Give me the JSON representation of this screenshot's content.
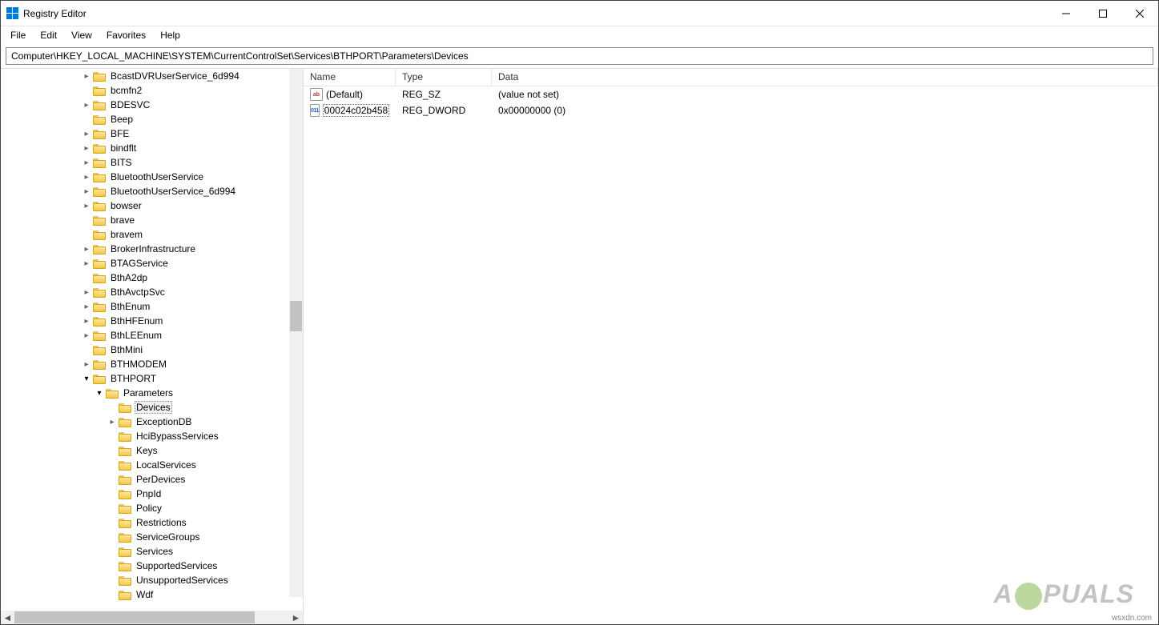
{
  "window": {
    "title": "Registry Editor"
  },
  "menu": {
    "file": "File",
    "edit": "Edit",
    "view": "View",
    "favorites": "Favorites",
    "help": "Help"
  },
  "addressbar": {
    "path": "Computer\\HKEY_LOCAL_MACHINE\\SYSTEM\\CurrentControlSet\\Services\\BTHPORT\\Parameters\\Devices"
  },
  "headers": {
    "name": "Name",
    "type": "Type",
    "data": "Data"
  },
  "values": [
    {
      "icon": "str",
      "name": "(Default)",
      "type": "REG_SZ",
      "data": "(value not set)",
      "selected": false
    },
    {
      "icon": "bin",
      "name": "00024c02b458",
      "type": "REG_DWORD",
      "data": "0x00000000 (0)",
      "selected": true
    }
  ],
  "tree": [
    {
      "depth": 6,
      "expander": ">",
      "label": "BcastDVRUserService_6d994"
    },
    {
      "depth": 6,
      "expander": "",
      "label": "bcmfn2"
    },
    {
      "depth": 6,
      "expander": ">",
      "label": "BDESVC"
    },
    {
      "depth": 6,
      "expander": "",
      "label": "Beep"
    },
    {
      "depth": 6,
      "expander": ">",
      "label": "BFE"
    },
    {
      "depth": 6,
      "expander": ">",
      "label": "bindflt"
    },
    {
      "depth": 6,
      "expander": ">",
      "label": "BITS"
    },
    {
      "depth": 6,
      "expander": ">",
      "label": "BluetoothUserService"
    },
    {
      "depth": 6,
      "expander": ">",
      "label": "BluetoothUserService_6d994"
    },
    {
      "depth": 6,
      "expander": ">",
      "label": "bowser"
    },
    {
      "depth": 6,
      "expander": "",
      "label": "brave"
    },
    {
      "depth": 6,
      "expander": "",
      "label": "bravem"
    },
    {
      "depth": 6,
      "expander": ">",
      "label": "BrokerInfrastructure"
    },
    {
      "depth": 6,
      "expander": ">",
      "label": "BTAGService"
    },
    {
      "depth": 6,
      "expander": "",
      "label": "BthA2dp"
    },
    {
      "depth": 6,
      "expander": ">",
      "label": "BthAvctpSvc"
    },
    {
      "depth": 6,
      "expander": ">",
      "label": "BthEnum"
    },
    {
      "depth": 6,
      "expander": ">",
      "label": "BthHFEnum"
    },
    {
      "depth": 6,
      "expander": ">",
      "label": "BthLEEnum"
    },
    {
      "depth": 6,
      "expander": "",
      "label": "BthMini"
    },
    {
      "depth": 6,
      "expander": ">",
      "label": "BTHMODEM"
    },
    {
      "depth": 6,
      "expander": "v",
      "label": "BTHPORT"
    },
    {
      "depth": 7,
      "expander": "v",
      "label": "Parameters"
    },
    {
      "depth": 8,
      "expander": "",
      "label": "Devices",
      "selected": true
    },
    {
      "depth": 8,
      "expander": ">",
      "label": "ExceptionDB"
    },
    {
      "depth": 8,
      "expander": "",
      "label": "HciBypassServices"
    },
    {
      "depth": 8,
      "expander": "",
      "label": "Keys"
    },
    {
      "depth": 8,
      "expander": "",
      "label": "LocalServices"
    },
    {
      "depth": 8,
      "expander": "",
      "label": "PerDevices"
    },
    {
      "depth": 8,
      "expander": "",
      "label": "PnpId"
    },
    {
      "depth": 8,
      "expander": "",
      "label": "Policy"
    },
    {
      "depth": 8,
      "expander": "",
      "label": "Restrictions"
    },
    {
      "depth": 8,
      "expander": "",
      "label": "ServiceGroups"
    },
    {
      "depth": 8,
      "expander": "",
      "label": "Services"
    },
    {
      "depth": 8,
      "expander": "",
      "label": "SupportedServices"
    },
    {
      "depth": 8,
      "expander": "",
      "label": "UnsupportedServices"
    },
    {
      "depth": 8,
      "expander": "",
      "label": "Wdf"
    }
  ],
  "watermark": {
    "text_a": "A",
    "text_b": "PUALS"
  },
  "source_note": "wsxdn.com"
}
